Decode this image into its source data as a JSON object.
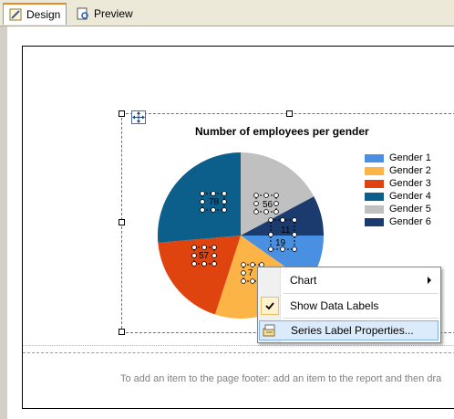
{
  "tabs": [
    {
      "label": "Design"
    },
    {
      "label": "Preview"
    }
  ],
  "report": {
    "footer_hint": "To add an item to the page footer: add an item to the report and then dra"
  },
  "chart": {
    "title": "Number of employees per gender"
  },
  "chart_data": {
    "type": "pie",
    "title": "Number of employees per gender",
    "slices": [
      {
        "name": "Gender 1",
        "color": "#4a90e2"
      },
      {
        "name": "Gender 2",
        "color": "#fbb445"
      },
      {
        "name": "Gender 3",
        "color": "#e0440e"
      },
      {
        "name": "Gender 4",
        "color": "#0b5f8a"
      },
      {
        "name": "Gender 5",
        "color": "#c0c0c0"
      },
      {
        "name": "Gender 6",
        "color": "#1b3a6e"
      }
    ],
    "data_labels": [
      "78",
      "56",
      "57",
      "19",
      "11",
      "7"
    ],
    "legend": "right"
  },
  "context_menu": {
    "items": [
      {
        "label": "Chart",
        "has_submenu": true
      },
      {
        "label": "Show Data Labels",
        "checked": true
      },
      {
        "label": "Series Label Properties...",
        "highlighted": true
      }
    ]
  }
}
